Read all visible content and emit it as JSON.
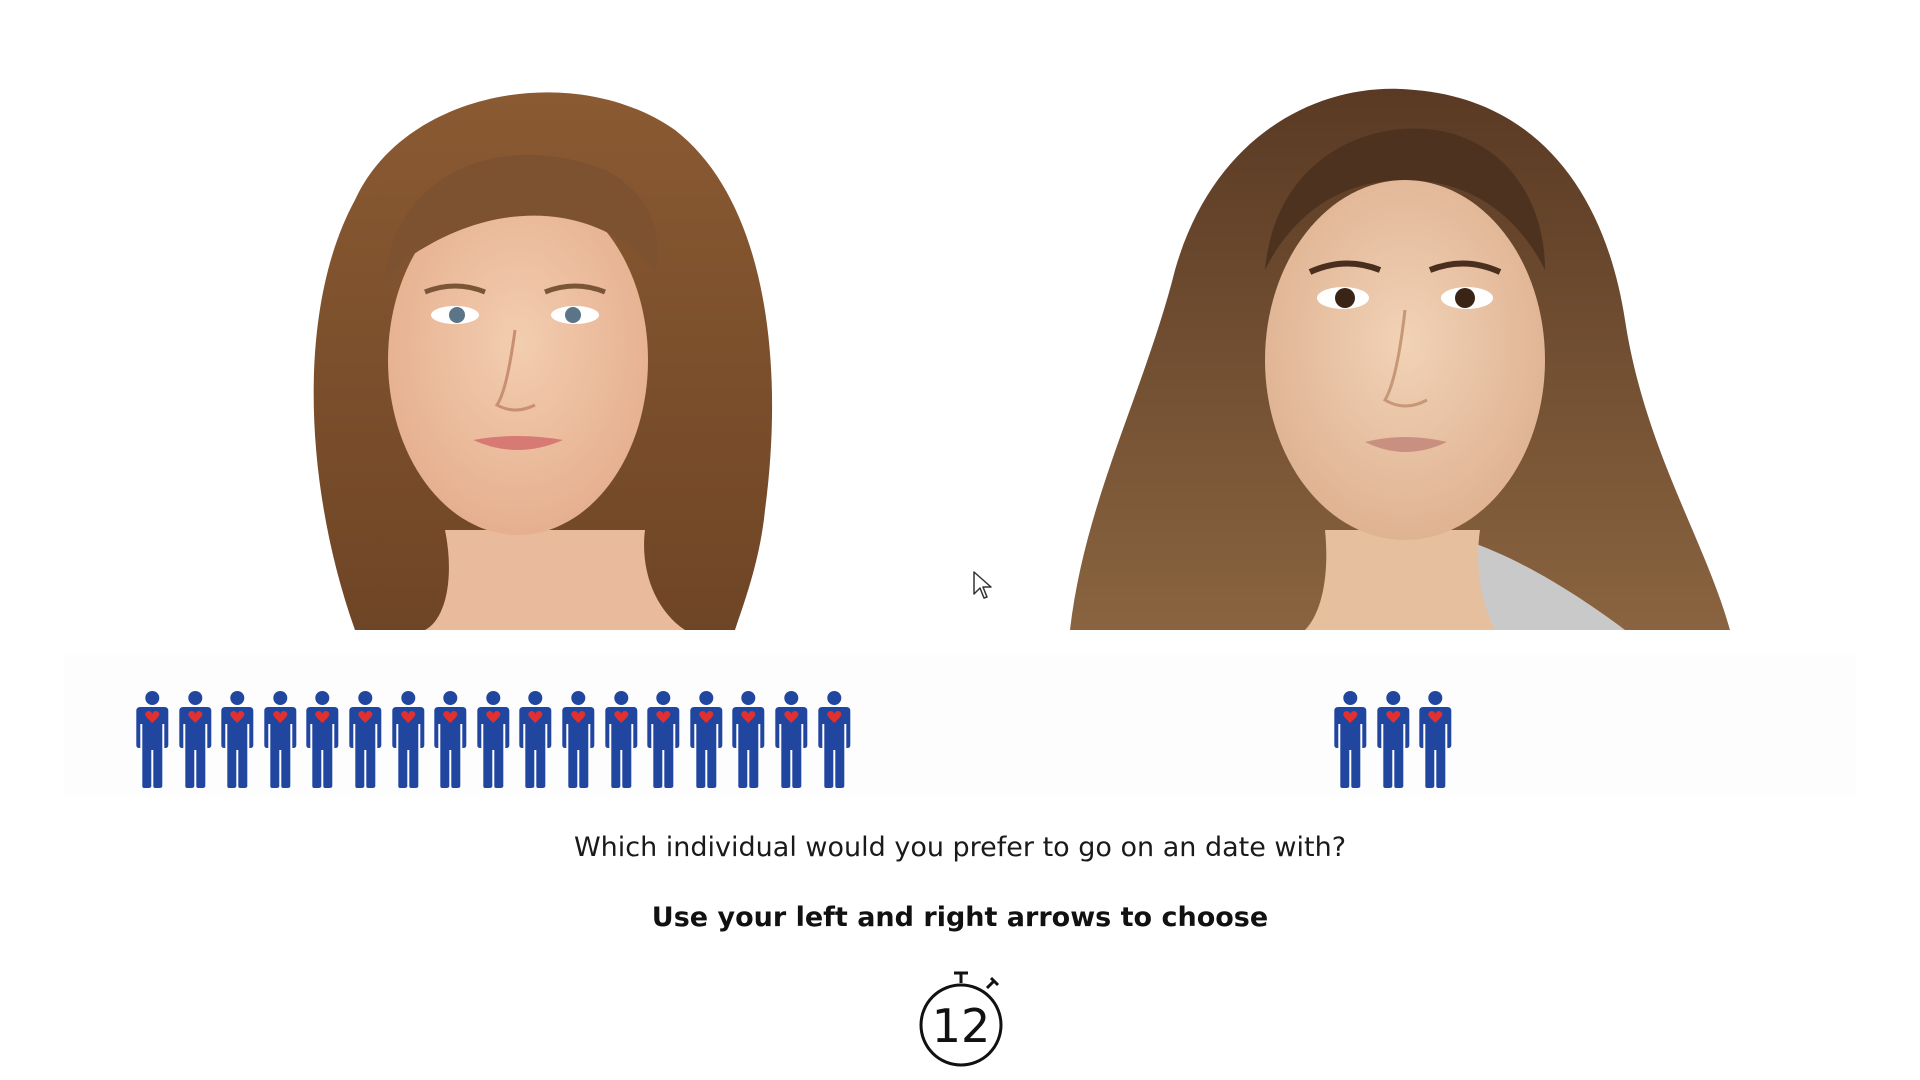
{
  "left_option": {
    "name": "left-face-photo",
    "figure_count": 17,
    "figure_icon": "person-with-heart-icon"
  },
  "right_option": {
    "name": "right-face-photo",
    "figure_count": 3,
    "figure_icon": "person-with-heart-icon"
  },
  "colors": {
    "figure_body": "#2146a0",
    "figure_heart": "#e03030",
    "background": "#ffffff"
  },
  "question": "Which individual would you prefer to go on an date with?",
  "instruction": "Use your left and right arrows to choose",
  "timer": {
    "icon": "stopwatch-icon",
    "value": "12"
  },
  "cursor_icon": "mouse-pointer-icon"
}
